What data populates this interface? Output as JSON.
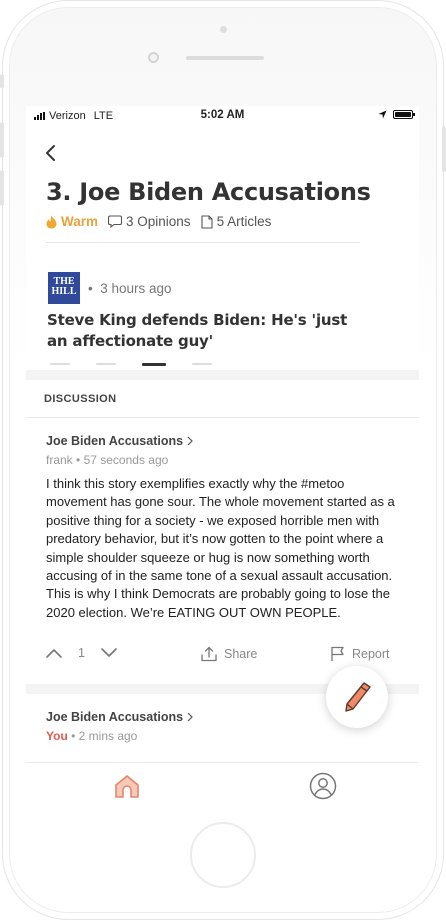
{
  "status_bar": {
    "carrier": "Verizon",
    "network": "LTE",
    "time": "5:02 AM"
  },
  "story": {
    "title": "3. Joe Biden Accusations",
    "heat": "Warm",
    "opinions": "3 Opinions",
    "articles": "5 Articles"
  },
  "article": {
    "source_logo_line1": "THE",
    "source_logo_line2": "HILL",
    "time": "3 hours ago",
    "headline": "Steve King defends Biden: He's 'just an affectionate guy'",
    "pager_total": 4,
    "pager_active": 3
  },
  "discussion": {
    "header": "DISCUSSION",
    "posts": [
      {
        "topic": "Joe Biden Accusations",
        "author": "frank",
        "time": "57 seconds ago",
        "body": "I think this story exemplifies exactly why the #metoo movement has gone sour. The whole movement started as a positive thing for a society - we exposed horrible men with predatory behavior, but it’s now gotten to the point where a simple shoulder squeeze or hug is now something worth accusing of in the same tone of a sexual assault accusation. This is why I think Democrats are probably going to lose the 2020 election. We’re EATING OUT OWN PEOPLE.",
        "votes": "1",
        "share_label": "Share",
        "report_label": "Report"
      },
      {
        "topic": "Joe Biden Accusations",
        "author": "You",
        "time": "2 mins ago"
      }
    ]
  },
  "colors": {
    "warm": "#e8a13c",
    "you": "#e05a4f",
    "home_tab": "#e8846a",
    "hill_logo": "#2f4a9a"
  },
  "icons": [
    "back-icon",
    "flame-icon",
    "opinion-bubble-icon",
    "article-icon",
    "upvote-icon",
    "downvote-icon",
    "share-icon",
    "flag-icon",
    "pencil-icon",
    "home-icon",
    "profile-icon"
  ]
}
